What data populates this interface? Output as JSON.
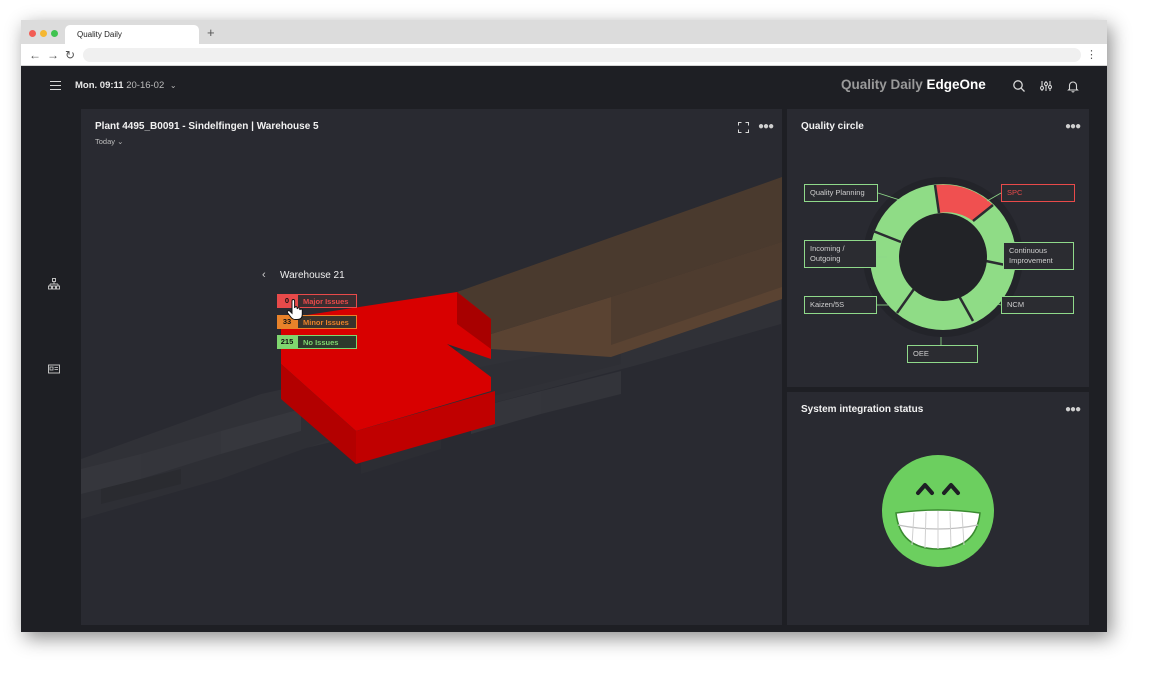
{
  "browser": {
    "tab_title": "Quality Daily",
    "new_tab": "+"
  },
  "header": {
    "time": "Mon. 09:11",
    "date": "20-16-02",
    "brand_light": "Quality Daily",
    "brand_bold": "EdgeOne"
  },
  "main": {
    "title": "Plant 4495_B0091 - Sindelfingen | Warehouse 5",
    "period": "Today",
    "warehouse": "Warehouse 21",
    "issues": {
      "major": {
        "count": "0",
        "label": "Major Issues"
      },
      "minor": {
        "count": "33",
        "label": "Minor Issues"
      },
      "none": {
        "count": "215",
        "label": "No Issues"
      }
    }
  },
  "quality_circle": {
    "title": "Quality circle",
    "labels": {
      "quality_planning": "Quality Planning",
      "spc": "SPC",
      "incoming_outgoing_1": "Incoming /",
      "incoming_outgoing_2": "Outgoing",
      "continuous_1": "Continuous",
      "continuous_2": "Improvement",
      "kaizen": "Kaizen/5S",
      "ncm": "NCM",
      "oee": "OEE"
    }
  },
  "system_status": {
    "title": "System integration status"
  },
  "colors": {
    "accent_red": "#e84a4a",
    "accent_orange": "#e8822a",
    "accent_green": "#7fd66f",
    "background": "#1e1f24",
    "panel": "#292a31"
  }
}
